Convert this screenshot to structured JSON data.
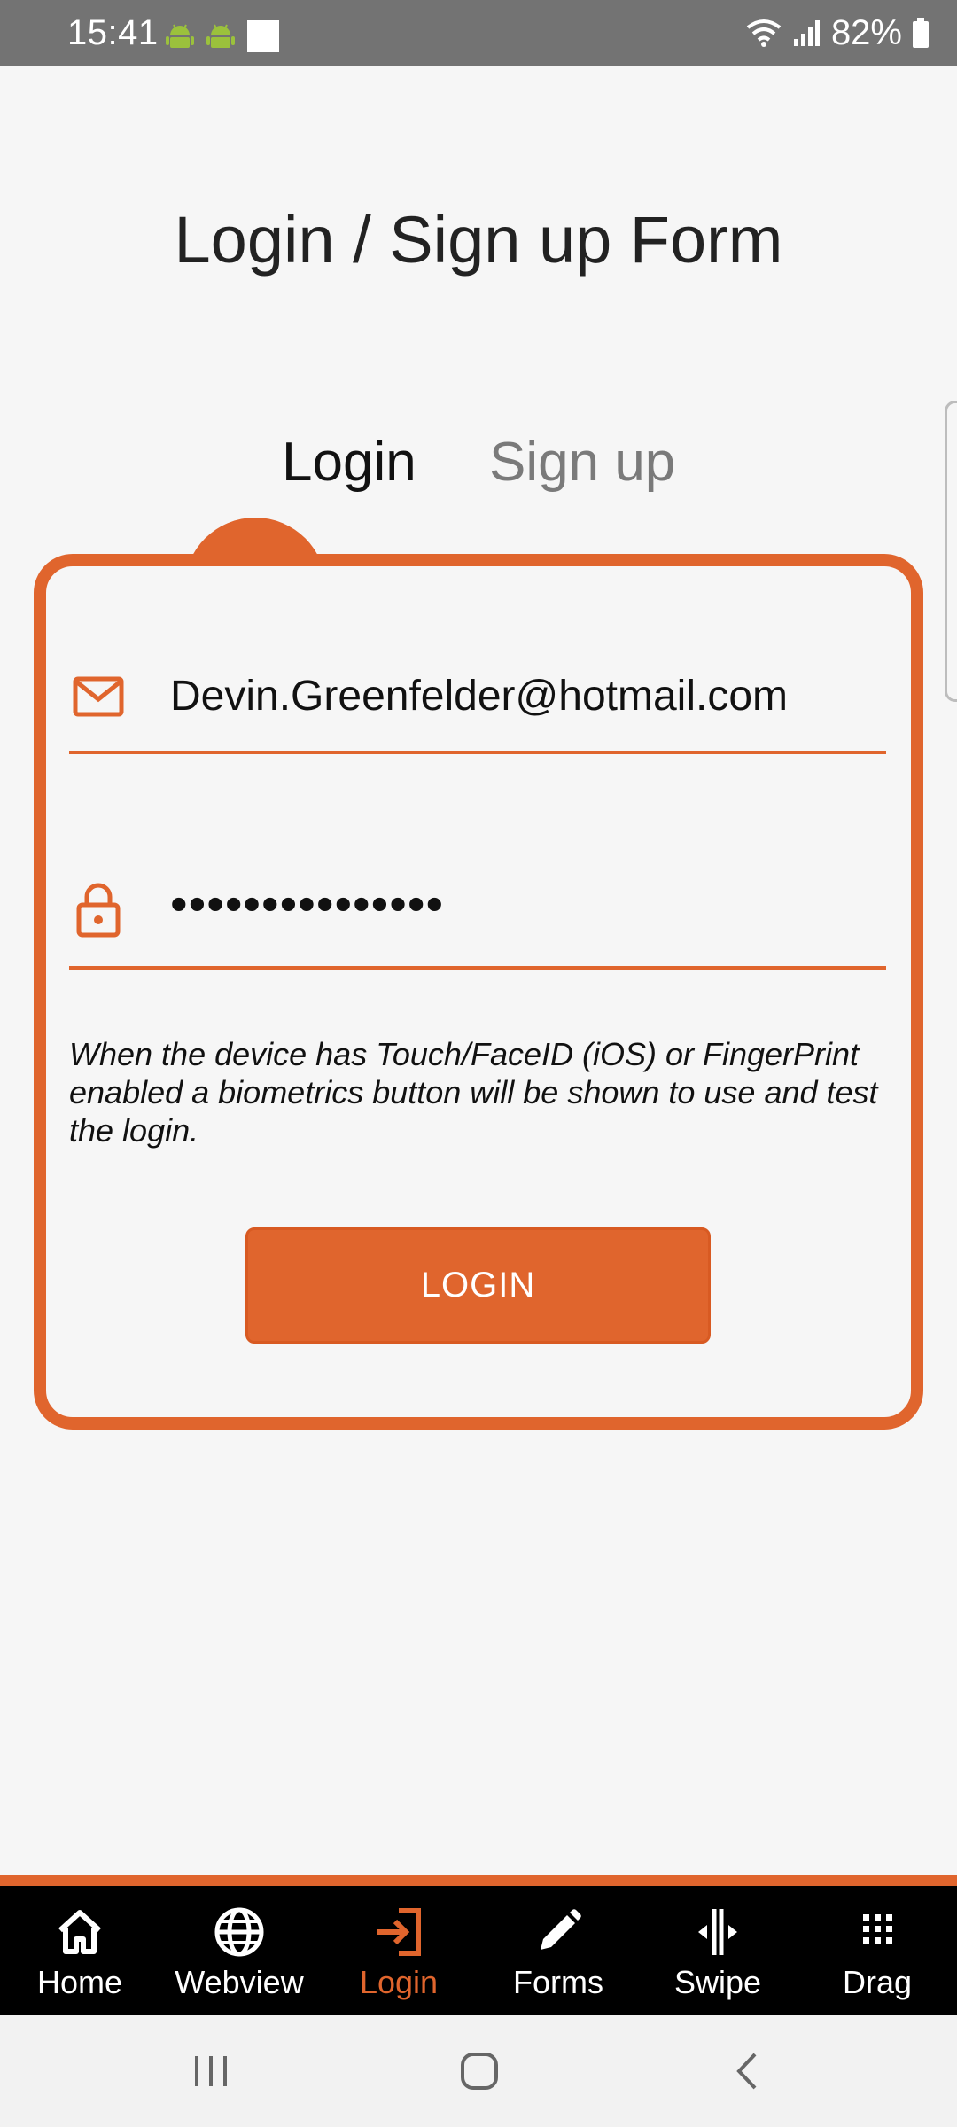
{
  "status_bar": {
    "time": "15:41",
    "battery": "82%",
    "icons": [
      "android-icon",
      "android-icon",
      "square-notification-icon",
      "wifi-icon",
      "signal-icon",
      "battery-icon"
    ]
  },
  "page": {
    "title": "Login / Sign up Form"
  },
  "tabs": [
    {
      "label": "Login",
      "active": true
    },
    {
      "label": "Sign up",
      "active": false
    }
  ],
  "form": {
    "email": {
      "icon": "mail-icon",
      "value": "Devin.Greenfelder@hotmail.com"
    },
    "password": {
      "icon": "lock-icon",
      "value": "•••••••••••••••"
    },
    "hint": "When the device has Touch/FaceID (iOS) or FingerPrint enabled a biometrics button will be shown to use and test the login.",
    "submit_label": "LOGIN"
  },
  "bottom_nav": {
    "items": [
      {
        "label": "Home",
        "icon": "home-icon",
        "active": false
      },
      {
        "label": "Webview",
        "icon": "globe-icon",
        "active": false
      },
      {
        "label": "Login",
        "icon": "login-icon",
        "active": true
      },
      {
        "label": "Forms",
        "icon": "pencil-icon",
        "active": false
      },
      {
        "label": "Swipe",
        "icon": "swipe-icon",
        "active": false
      },
      {
        "label": "Drag",
        "icon": "grid-dots-icon",
        "active": false
      }
    ]
  },
  "colors": {
    "accent": "#e0652d",
    "status_bar": "#737373",
    "tabbar_bg": "#000000",
    "background": "#f6f6f6"
  }
}
